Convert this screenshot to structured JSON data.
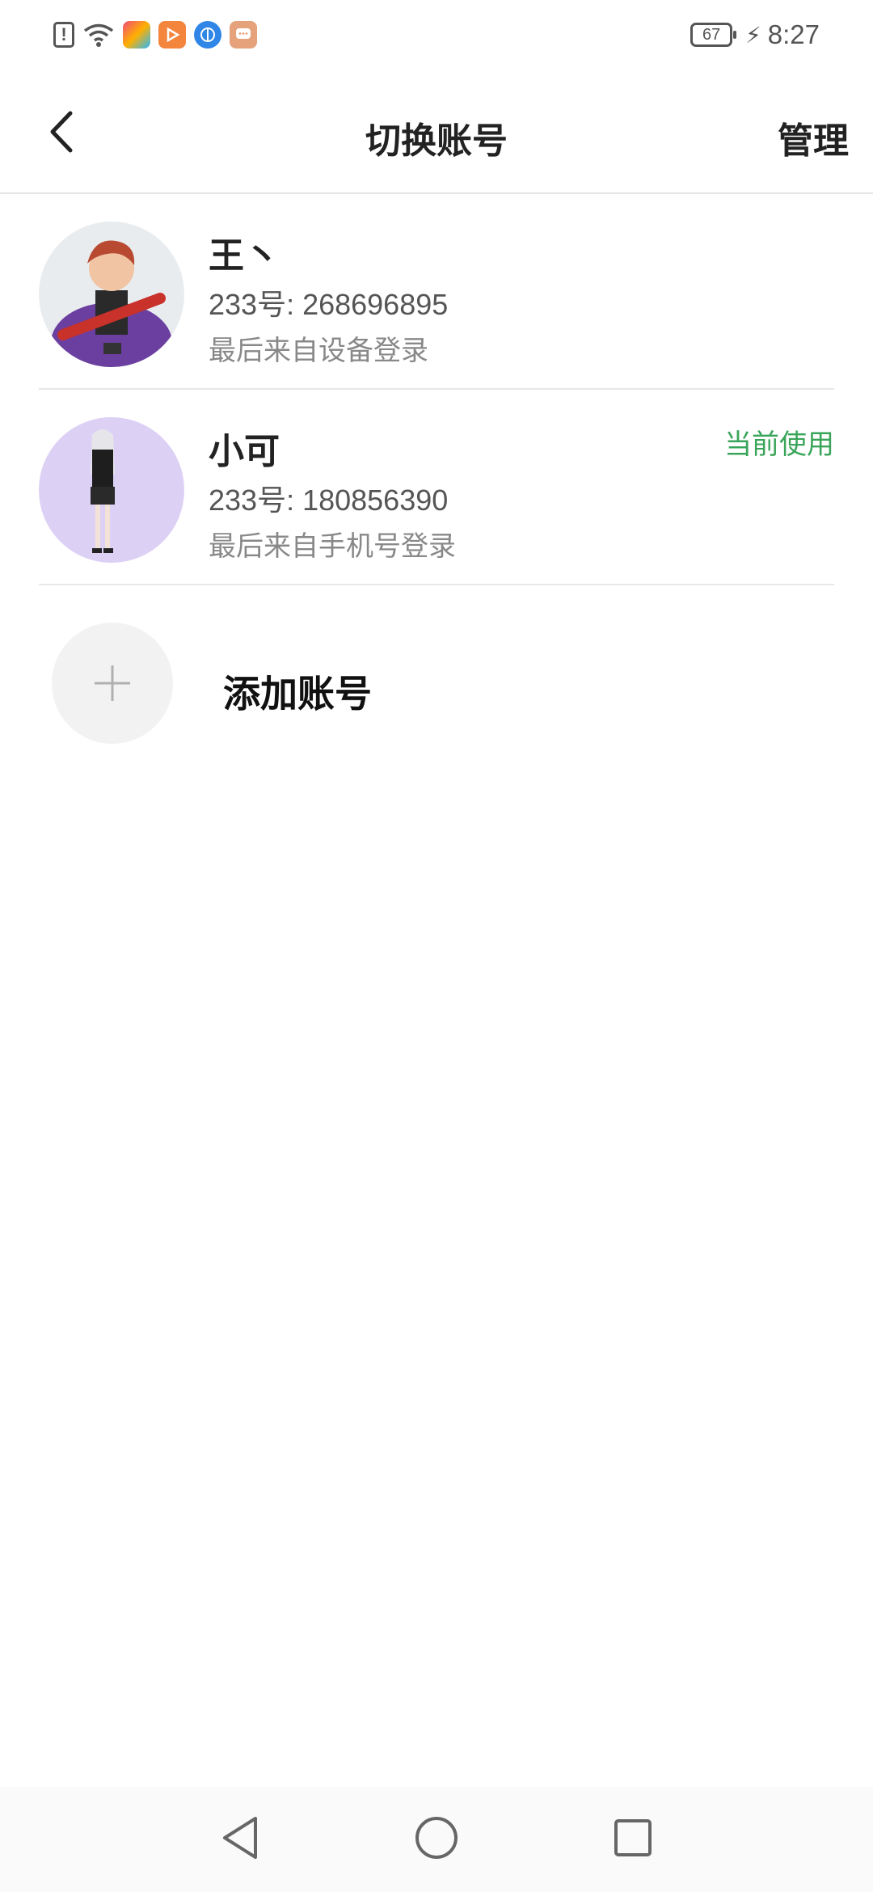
{
  "status_bar": {
    "battery": "67",
    "time": "8:27",
    "icons": [
      "sim-alert-icon",
      "wifi-icon",
      "app-toolbox-icon",
      "app-video-icon",
      "app-browser-icon",
      "app-chat-icon"
    ]
  },
  "header": {
    "title": "切换账号",
    "manage_label": "管理"
  },
  "accounts": [
    {
      "name": "王丶",
      "id_text": "233号: 268696895",
      "source": "最后来自设备登录",
      "current": false
    },
    {
      "name": "小可",
      "id_text": "233号: 180856390",
      "source": "最后来自手机号登录",
      "current": true,
      "current_label": "当前使用"
    }
  ],
  "add_account": {
    "label": "添加账号"
  },
  "colors": {
    "accent_green": "#3aa55a",
    "divider": "#e8e8e8"
  },
  "nav": [
    "back-nav-icon",
    "home-nav-icon",
    "recents-nav-icon"
  ]
}
